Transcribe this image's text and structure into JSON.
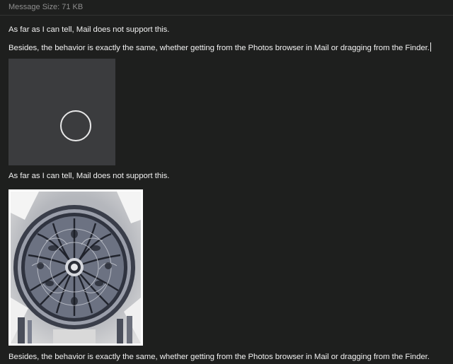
{
  "header": {
    "message_size": "Message Size: 71 KB"
  },
  "body": {
    "line1": "As far as I can tell, Mail does not support this.",
    "line2": "Besides, the behavior is exactly the same, whether getting from the Photos browser in Mail or dragging from the Finder.",
    "line3": "As far as I can tell, Mail does not support this.",
    "line4": "Besides, the behavior is exactly the same, whether getting from the Photos browser in Mail or dragging from the Finder."
  },
  "icons": {
    "placeholder": "loading-ring-icon",
    "photo": "rose-window-photo"
  },
  "colors": {
    "background": "#1e1f1e",
    "text": "#f0f0f0",
    "muted": "#8e8e8e",
    "placeholder": "#3b3c3e"
  }
}
